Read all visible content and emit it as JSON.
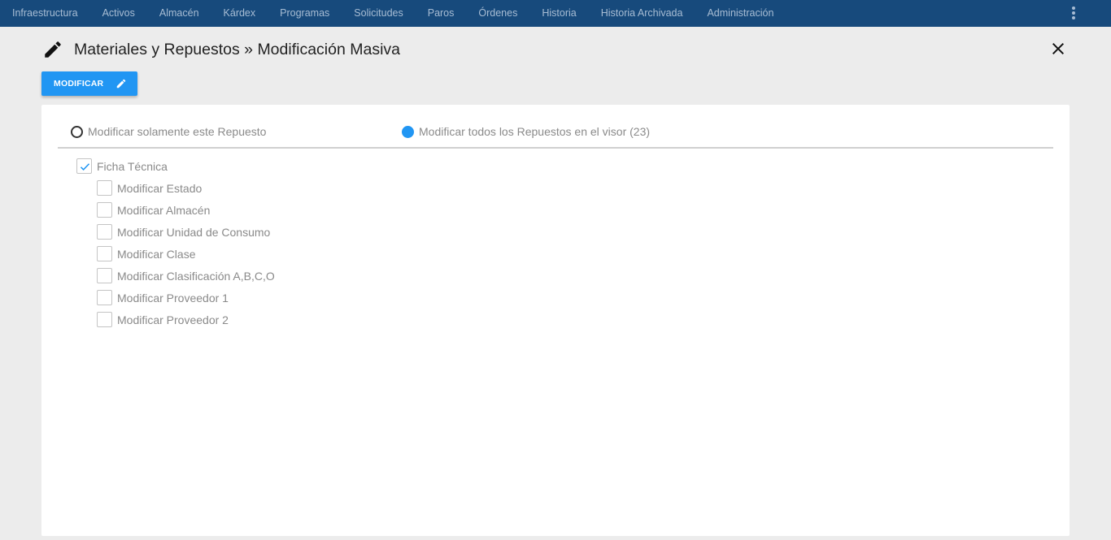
{
  "topnav": {
    "items": [
      "Infraestructura",
      "Activos",
      "Almacén",
      "Kárdex",
      "Programas",
      "Solicitudes",
      "Paros",
      "Órdenes",
      "Historia",
      "Historia Archivada",
      "Administración"
    ],
    "menu_icon": "more-vert-icon"
  },
  "header": {
    "icon": "pencil-icon",
    "title": "Materiales y Repuestos » Modificación Masiva",
    "close_icon": "close-icon"
  },
  "toolbar": {
    "modify_label": "MODIFICAR",
    "modify_icon": "pencil-icon"
  },
  "scope": {
    "options": [
      {
        "label": "Modificar solamente este Repuesto",
        "selected": false
      },
      {
        "label": "Modificar todos los Repuestos en el visor (23)",
        "selected": true
      }
    ]
  },
  "sections": {
    "parent": {
      "label": "Ficha Técnica",
      "checked": true
    },
    "children": [
      {
        "label": "Modificar Estado",
        "checked": false
      },
      {
        "label": "Modificar Almacén",
        "checked": false
      },
      {
        "label": "Modificar Unidad de Consumo",
        "checked": false
      },
      {
        "label": "Modificar Clase",
        "checked": false
      },
      {
        "label": "Modificar Clasificación A,B,C,O",
        "checked": false
      },
      {
        "label": "Modificar Proveedor 1",
        "checked": false
      },
      {
        "label": "Modificar Proveedor 2",
        "checked": false
      }
    ]
  },
  "colors": {
    "nav_bg": "#174a7c",
    "accent": "#2196f3",
    "page_bg": "#ececec"
  }
}
